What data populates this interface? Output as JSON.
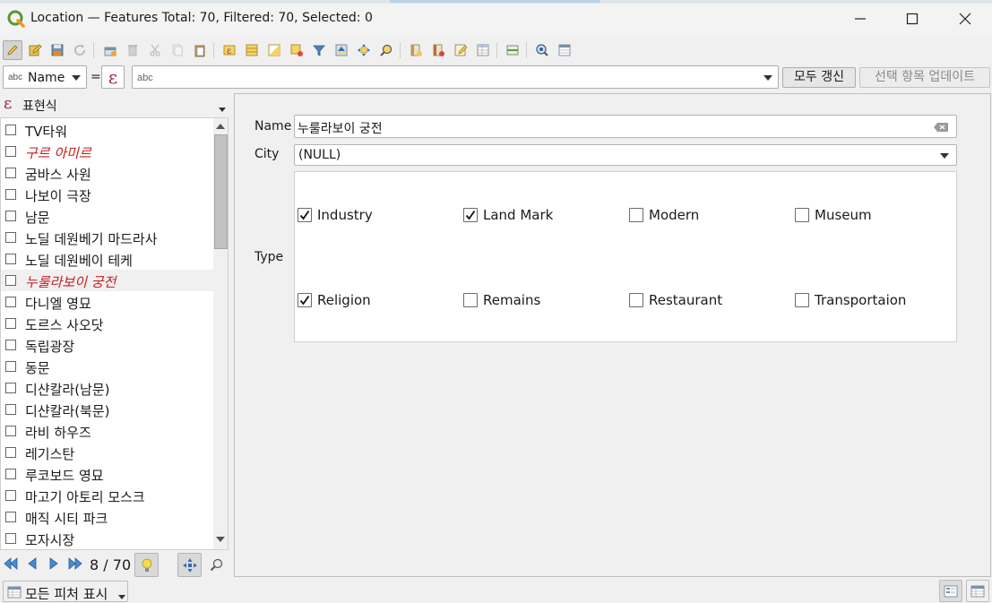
{
  "window": {
    "title": "Location — Features Total: 70, Filtered: 70, Selected: 0"
  },
  "toolbar": {
    "icons": [
      "toggle-edit-icon",
      "multi-edit-icon",
      "save-edits-icon",
      "reload-icon",
      "add-feature-icon",
      "delete-feature-icon",
      "cut-icon",
      "copy-icon",
      "paste-icon",
      "select-by-expression-icon",
      "select-all-icon",
      "invert-selection-icon",
      "filter-icon",
      "deselect-icon",
      "move-selection-top-icon",
      "pan-to-selection-icon",
      "zoom-to-selection-icon",
      "new-field-icon",
      "delete-field-icon",
      "field-calculator-icon",
      "conditional-formatting-icon",
      "dock-toggle-icon",
      "actions-icon",
      "switch-view-icon"
    ]
  },
  "filter": {
    "field_type": "abc",
    "field_name": "Name",
    "equals": "=",
    "placeholder": "abc",
    "update_all": "모두 갱신",
    "update_selected": "선택 항목 업데이트"
  },
  "list": {
    "header": "표현식",
    "items": [
      {
        "label": "TV타워",
        "highlight": false
      },
      {
        "label": "구르 아미르",
        "highlight": true
      },
      {
        "label": "굼바스 사원",
        "highlight": false
      },
      {
        "label": "나보이 극장",
        "highlight": false
      },
      {
        "label": "남문",
        "highlight": false
      },
      {
        "label": "노딜 데원베기 마드라사",
        "highlight": false
      },
      {
        "label": "노딜 데원베이 테케",
        "highlight": false
      },
      {
        "label": "누룰라보이 궁전",
        "highlight": true
      },
      {
        "label": "다니엘 영묘",
        "highlight": false
      },
      {
        "label": "도르스 사오닷",
        "highlight": false
      },
      {
        "label": "독립광장",
        "highlight": false
      },
      {
        "label": "동문",
        "highlight": false
      },
      {
        "label": "디샨칼라(남문)",
        "highlight": false
      },
      {
        "label": "디샨칼라(북문)",
        "highlight": false
      },
      {
        "label": "라비 하우즈",
        "highlight": false
      },
      {
        "label": "레기스탄",
        "highlight": false
      },
      {
        "label": "루코보드 영묘",
        "highlight": false
      },
      {
        "label": "마고기 아토리 모스크",
        "highlight": false
      },
      {
        "label": "매직 시티 파크",
        "highlight": false
      },
      {
        "label": "모자시장",
        "highlight": false
      }
    ],
    "selected_index": 7
  },
  "nav": {
    "current": "8",
    "separator": "/",
    "total": "70"
  },
  "form": {
    "name_label": "Name",
    "name_value": "누룰라보이 궁전",
    "city_label": "City",
    "city_value": "(NULL)",
    "type_label": "Type",
    "types": [
      {
        "label": "Industry",
        "checked": true
      },
      {
        "label": "Land Mark",
        "checked": true
      },
      {
        "label": "Modern",
        "checked": false
      },
      {
        "label": "Museum",
        "checked": false
      },
      {
        "label": "Religion",
        "checked": true
      },
      {
        "label": "Remains",
        "checked": false
      },
      {
        "label": "Restaurant",
        "checked": false
      },
      {
        "label": "Transportaion",
        "checked": false
      }
    ]
  },
  "footer": {
    "show_all": "모든 피처 표시"
  },
  "colors": {
    "accent": "#a0224b",
    "highlight_text": "#c41e1e",
    "qgis_green": "#589632",
    "nav_blue": "#2f6db5"
  }
}
